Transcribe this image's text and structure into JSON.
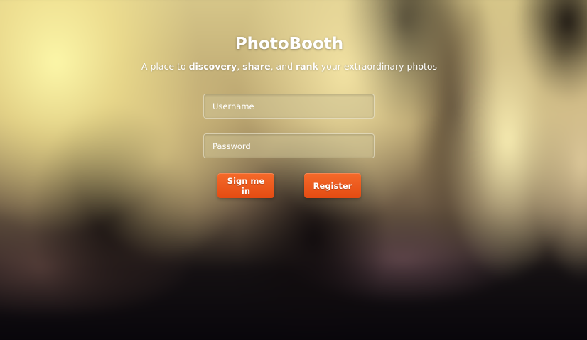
{
  "header": {
    "title": "PhotoBooth",
    "tagline": {
      "prefix": "A place to ",
      "word1": "discovery",
      "sep1": ", ",
      "word2": "share",
      "sep2": ", and ",
      "word3": "rank",
      "suffix": " your extraordinary photos"
    }
  },
  "form": {
    "username_placeholder": "Username",
    "username_value": "",
    "password_placeholder": "Password",
    "password_value": ""
  },
  "actions": {
    "signin_label": "Sign me in",
    "register_label": "Register"
  },
  "colors": {
    "button_accent": "#ee5a1c",
    "text": "#ffffff"
  }
}
